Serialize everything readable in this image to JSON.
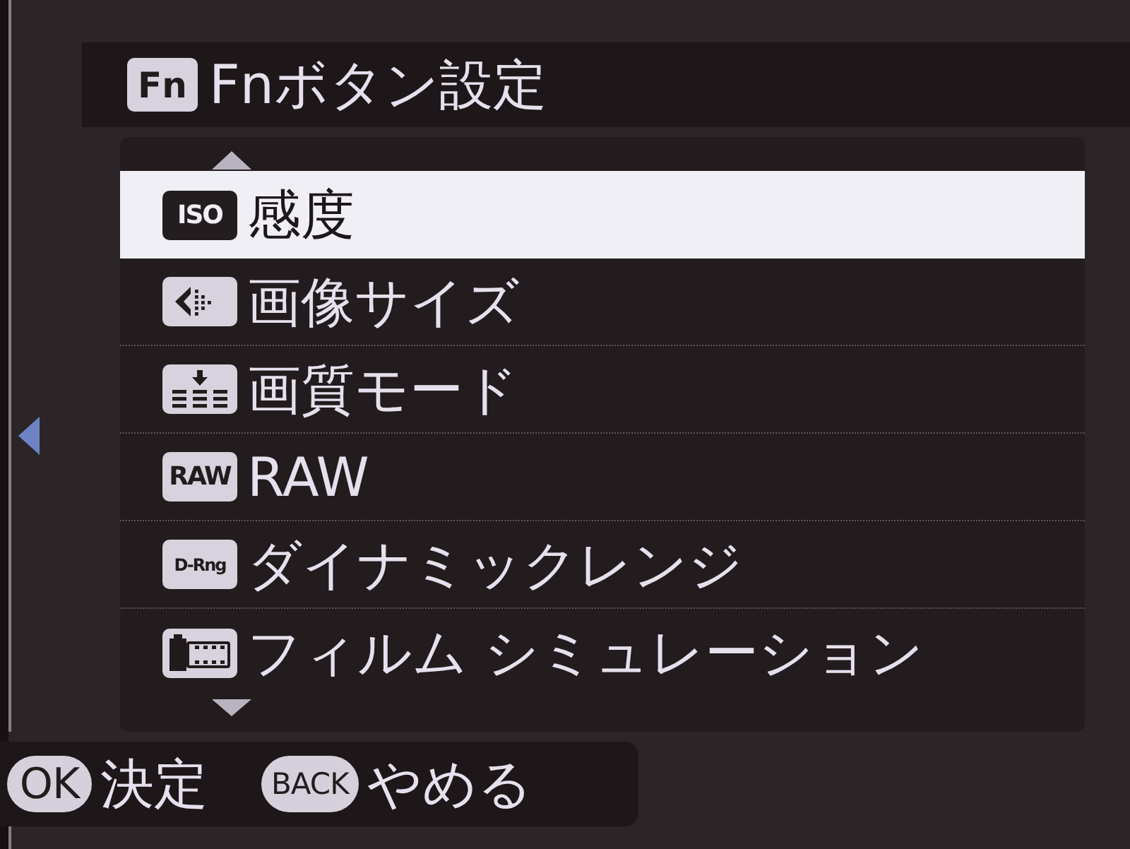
{
  "title": {
    "badge": "Fn",
    "text": "Fnボタン設定"
  },
  "menu": {
    "items": [
      {
        "kind": "lettered",
        "badge": "ISO",
        "label": "感度",
        "selected": true
      },
      {
        "kind": "size",
        "label": "画像サイズ",
        "selected": false
      },
      {
        "kind": "quality",
        "label": "画質モード",
        "selected": false
      },
      {
        "kind": "lettered",
        "badge": "RAW",
        "label": "RAW",
        "selected": false
      },
      {
        "kind": "lettered",
        "badge": "D-Rng",
        "label": "ダイナミックレンジ",
        "selected": false
      },
      {
        "kind": "film",
        "label": "フィルム シミュレーション",
        "selected": false
      }
    ]
  },
  "footer": {
    "hints": [
      {
        "key": "OK",
        "label": "決定"
      },
      {
        "key": "BACK",
        "label": "やめる"
      }
    ]
  }
}
